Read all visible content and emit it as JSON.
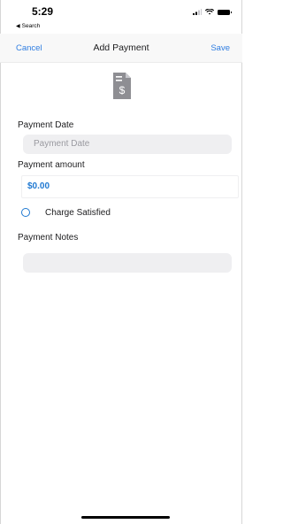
{
  "status_bar": {
    "time": "5:29",
    "back_app": "Search"
  },
  "nav": {
    "cancel_label": "Cancel",
    "title": "Add Payment",
    "save_label": "Save"
  },
  "form": {
    "payment_date_label": "Payment Date",
    "payment_date_placeholder": "Payment Date",
    "payment_amount_label": "Payment amount",
    "payment_amount_value": "$0.00",
    "charge_satisfied_label": "Charge Satisfied",
    "payment_notes_label": "Payment Notes",
    "payment_notes_value": ""
  },
  "icons": {
    "document": "document-dollar-icon",
    "radio": "radio-unchecked-icon",
    "signal": "cellular-signal-icon",
    "wifi": "wifi-icon",
    "battery": "battery-icon"
  },
  "colors": {
    "accent": "#2f7de1",
    "amount": "#1f78d1",
    "field_bg": "#efeff1",
    "icon": "#8e8e93"
  }
}
